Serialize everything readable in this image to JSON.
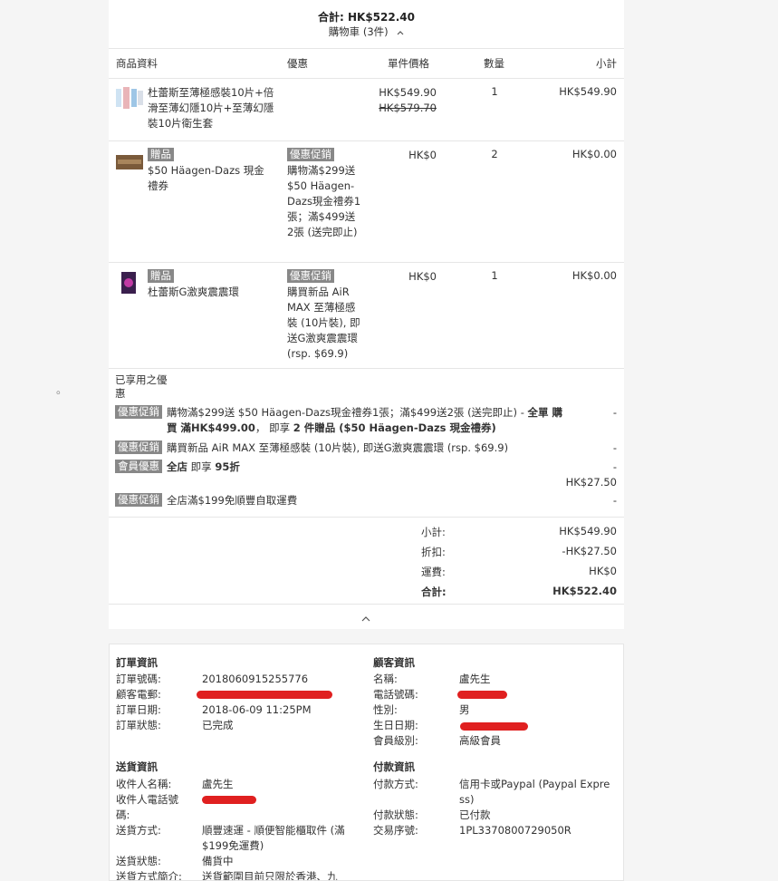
{
  "page_dot": "。",
  "header": {
    "total": "合計: HK$522.40",
    "cart_toggle": "購物車 (3件)",
    "caret_up": "^"
  },
  "columns": {
    "product": "商品資料",
    "promo": "優惠",
    "unit_price": "單件價格",
    "qty": "數量",
    "subtotal": "小計"
  },
  "items": [
    {
      "name": "杜蕾斯至薄極感裝10片+倍滑至薄幻隱10片+至薄幻隱裝10片衛生套",
      "tag": "",
      "promo_tag": "",
      "promo_text": "",
      "price": "HK$549.90",
      "orig_price": "HK$579.70",
      "qty": "1",
      "subtotal": "HK$549.90"
    },
    {
      "name": "$50 Häagen-Dazs 現金禮券",
      "tag": "贈品",
      "promo_tag": "優惠促銷",
      "promo_text": "購物滿$299送$50 Häagen-Dazs現金禮券1張；滿$499送2張 (送完即止)",
      "price": "HK$0",
      "orig_price": "",
      "qty": "2",
      "subtotal": "HK$0.00"
    },
    {
      "name": "杜蕾斯G激爽震震環",
      "tag": "贈品",
      "promo_tag": "優惠促銷",
      "promo_text": "購買新品 AiR MAX 至薄極感裝 (10片裝), 即送G激爽震震環 (rsp. $69.9)",
      "price": "HK$0",
      "orig_price": "",
      "qty": "1",
      "subtotal": "HK$0.00"
    }
  ],
  "discounts": {
    "title": "已享用之優惠",
    "rows": [
      {
        "tag": "優惠促銷",
        "text_a": "購物滿$299送 $50 Häagen-Dazs現金禮券1張；滿$499送2張 (送完即止) - ",
        "text_b": "全單 購買 滿HK$499.00",
        "text_c": "， 即享 ",
        "text_d": "2 件贈品 ($50 Häagen-Dazs 現金禮券)",
        "amount": "-"
      },
      {
        "tag": "優惠促銷",
        "text_a": "購買新品 AiR MAX 至薄極感裝 (10片裝), 即送G激爽震震環 (rsp. $69.9)",
        "text_b": "",
        "text_c": "",
        "text_d": "",
        "amount": "-"
      },
      {
        "tag": "會員優惠",
        "text_a": "",
        "text_b": "全店",
        "text_c": " 即享 ",
        "text_d": "95折",
        "amount": "-",
        "amount2": "HK$27.50"
      },
      {
        "tag": "優惠促銷",
        "text_a": "全店滿$199免順豐自取運費",
        "text_b": "",
        "text_c": "",
        "text_d": "",
        "amount": "-"
      }
    ]
  },
  "summary": {
    "subtotal_label": "小計:",
    "subtotal": "HK$549.90",
    "discount_label": "折扣:",
    "discount": "-HK$27.50",
    "shipping_label": "運費:",
    "shipping": "HK$0",
    "total_label": "合計:",
    "total": "HK$522.40"
  },
  "order_info": {
    "title": "訂單資訊",
    "order_no_label": "訂單號碼:",
    "order_no": "2018060915255776",
    "email_label": "顧客電郵:",
    "date_label": "訂單日期:",
    "date": "2018-06-09 11:25PM",
    "status_label": "訂單狀態:",
    "status": "已完成"
  },
  "customer_info": {
    "title": "顧客資訊",
    "name_label": "名稱:",
    "name": "盧先生",
    "phone_label": "電話號碼:",
    "gender_label": "性別:",
    "gender": "男",
    "birthday_label": "生日日期:",
    "level_label": "會員級別:",
    "level": "高級會員"
  },
  "delivery_info": {
    "title": "送貨資訊",
    "recipient_label": "收件人名稱:",
    "recipient": "盧先生",
    "phone_label_a": "收件人電話號",
    "phone_label_b": "碼:",
    "method_label": "送貨方式:",
    "method": "順豐速運 - 順便智能櫃取件 (滿$199免運費)",
    "status_label": "送貨狀態:",
    "status": "備貨中",
    "desc_label": "送貨方式簡介:",
    "desc": "送貨範圍目前只限於香港、九"
  },
  "payment_info": {
    "title": "付款資訊",
    "method_label": "付款方式:",
    "method": "信用卡或Paypal (Paypal Express)",
    "status_label": "付款狀態:",
    "status": "已付款",
    "txn_label": "交易序號:",
    "txn": "1PL3370800729050R"
  },
  "colors": {
    "tag_bg": "#888888",
    "redaction": "#e02020"
  }
}
